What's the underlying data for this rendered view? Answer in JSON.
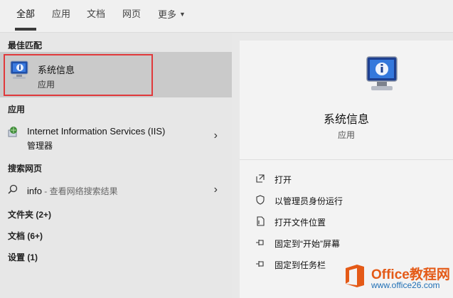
{
  "tabs": [
    {
      "label": "全部"
    },
    {
      "label": "应用"
    },
    {
      "label": "文档"
    },
    {
      "label": "网页"
    },
    {
      "label": "更多"
    }
  ],
  "left": {
    "best_match_title": "最佳匹配",
    "best_match": {
      "title": "系统信息",
      "subtitle": "应用"
    },
    "apps_title": "应用",
    "app_item": {
      "line1": "Internet Information Services (IIS)",
      "line2": "管理器"
    },
    "web_title": "搜索网页",
    "web_item": {
      "query": "info",
      "suffix": " - 查看网络搜索结果"
    },
    "folders": "文件夹 (2+)",
    "documents": "文档 (6+)",
    "settings": "设置 (1)"
  },
  "right": {
    "title": "系统信息",
    "subtitle": "应用",
    "actions": [
      {
        "label": "打开",
        "icon": "open-icon"
      },
      {
        "label": "以管理员身份运行",
        "icon": "shield-icon"
      },
      {
        "label": "打开文件位置",
        "icon": "file-location-icon"
      },
      {
        "label": "固定到“开始”屏幕",
        "icon": "pin-icon"
      },
      {
        "label": "固定到任务栏",
        "icon": "pin-icon"
      }
    ]
  },
  "watermark": {
    "title": "Office教程网",
    "url": "www.office26.com"
  },
  "colors": {
    "highlight_border": "#e0393b",
    "selected_bg": "#cacaca",
    "watermark_orange": "#e45a17"
  }
}
